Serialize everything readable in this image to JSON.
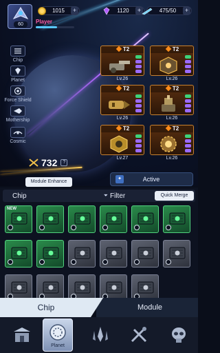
{
  "player": {
    "level": "60",
    "name": "Player",
    "xp_fraction": 0.55
  },
  "resources": {
    "gold": {
      "value": "1015",
      "plus": "+",
      "icon": "gold-coin-icon"
    },
    "gems": {
      "value": "1120",
      "plus": "+",
      "icon": "purple-gem-icon"
    },
    "energy": {
      "value": "475/50",
      "plus": "+",
      "icon": "ship-energy-icon"
    }
  },
  "side_menu": [
    {
      "label": "Chip",
      "icon": "list-icon"
    },
    {
      "label": "Planet",
      "icon": "planet-icon"
    },
    {
      "label": "Force Shield",
      "icon": "force-shield-icon"
    },
    {
      "label": "Mothership",
      "icon": "mothership-icon"
    },
    {
      "label": "Cosmic",
      "icon": "cosmic-icon"
    }
  ],
  "modules": [
    {
      "tier": "T2",
      "level": "Lv.26",
      "icon": "cannon-module-icon"
    },
    {
      "tier": "T2",
      "level": "Lv.26",
      "icon": "cube-module-icon"
    },
    {
      "tier": "T2",
      "level": "Lv.26",
      "icon": "drill-module-icon"
    },
    {
      "tier": "T2",
      "level": "Lv.26",
      "icon": "turret-module-icon"
    },
    {
      "tier": "T2",
      "level": "Lv.27",
      "icon": "hex-core-module-icon"
    },
    {
      "tier": "T2",
      "level": "Lv.26",
      "icon": "gear-orb-module-icon"
    }
  ],
  "power": {
    "value": "732",
    "help": "?"
  },
  "tabs": {
    "enhance": "Module Enhance",
    "active": "Active"
  },
  "inventory": {
    "title": "Chip",
    "filter": "Filter",
    "quick_merge": "Quick Merge",
    "new_tag": "NEW",
    "rows": [
      [
        "green",
        "green",
        "green",
        "green",
        "green",
        "green"
      ],
      [
        "green",
        "green",
        "gray",
        "gray",
        "gray",
        "gray"
      ],
      [
        "gray",
        "gray",
        "gray",
        "gray",
        "gray"
      ]
    ]
  },
  "segments": {
    "chip": "Chip",
    "module": "Module"
  },
  "nav": [
    {
      "label": "",
      "icon": "shop-icon"
    },
    {
      "label": "Planet",
      "icon": "planet-badge-icon",
      "selected": true
    },
    {
      "label": "",
      "icon": "fleet-icon"
    },
    {
      "label": "",
      "icon": "tools-icon"
    },
    {
      "label": "",
      "icon": "alien-skull-icon"
    }
  ],
  "colors": {
    "accent_blue": "#59c8ff",
    "player_name": "#ff5fa8",
    "card_border": "#c9822f",
    "chip_green": "#52d47f",
    "beam_purple": "#b36bff"
  }
}
